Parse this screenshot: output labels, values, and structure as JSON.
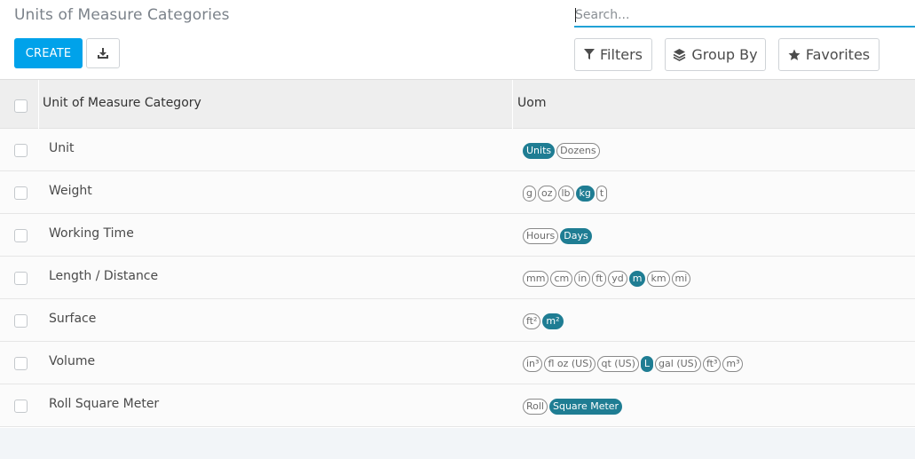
{
  "header": {
    "title": "Units of Measure Categories",
    "search_placeholder": "Search...",
    "create_label": "CREATE",
    "export_icon": "download-icon",
    "filters_label": "Filters",
    "groupby_label": "Group By",
    "favorites_label": "Favorites"
  },
  "table": {
    "columns": [
      "Unit of Measure Category",
      "Uom"
    ],
    "rows": [
      {
        "name": "Unit",
        "uoms": [
          {
            "label": "Units",
            "active": true
          },
          {
            "label": "Dozens",
            "active": false
          }
        ]
      },
      {
        "name": "Weight",
        "uoms": [
          {
            "label": "g",
            "active": false
          },
          {
            "label": "oz",
            "active": false
          },
          {
            "label": "lb",
            "active": false
          },
          {
            "label": "kg",
            "active": true
          },
          {
            "label": "t",
            "active": false
          }
        ]
      },
      {
        "name": "Working Time",
        "uoms": [
          {
            "label": "Hours",
            "active": false
          },
          {
            "label": "Days",
            "active": true
          }
        ]
      },
      {
        "name": "Length / Distance",
        "uoms": [
          {
            "label": "mm",
            "active": false
          },
          {
            "label": "cm",
            "active": false
          },
          {
            "label": "in",
            "active": false
          },
          {
            "label": "ft",
            "active": false
          },
          {
            "label": "yd",
            "active": false
          },
          {
            "label": "m",
            "active": true
          },
          {
            "label": "km",
            "active": false
          },
          {
            "label": "mi",
            "active": false
          }
        ]
      },
      {
        "name": "Surface",
        "uoms": [
          {
            "label": "ft²",
            "active": false
          },
          {
            "label": "m²",
            "active": true
          }
        ]
      },
      {
        "name": "Volume",
        "uoms": [
          {
            "label": "in³",
            "active": false
          },
          {
            "label": "fl oz (US)",
            "active": false
          },
          {
            "label": "qt (US)",
            "active": false
          },
          {
            "label": "L",
            "active": true
          },
          {
            "label": "gal (US)",
            "active": false
          },
          {
            "label": "ft³",
            "active": false
          },
          {
            "label": "m³",
            "active": false
          }
        ]
      },
      {
        "name": "Roll Square Meter",
        "uoms": [
          {
            "label": "Roll",
            "active": false
          },
          {
            "label": "Square Meter",
            "active": true
          }
        ]
      }
    ]
  },
  "colors": {
    "primary": "#00a2ea",
    "tag_active": "#1f7d93",
    "search_underline": "#21a2d6"
  }
}
